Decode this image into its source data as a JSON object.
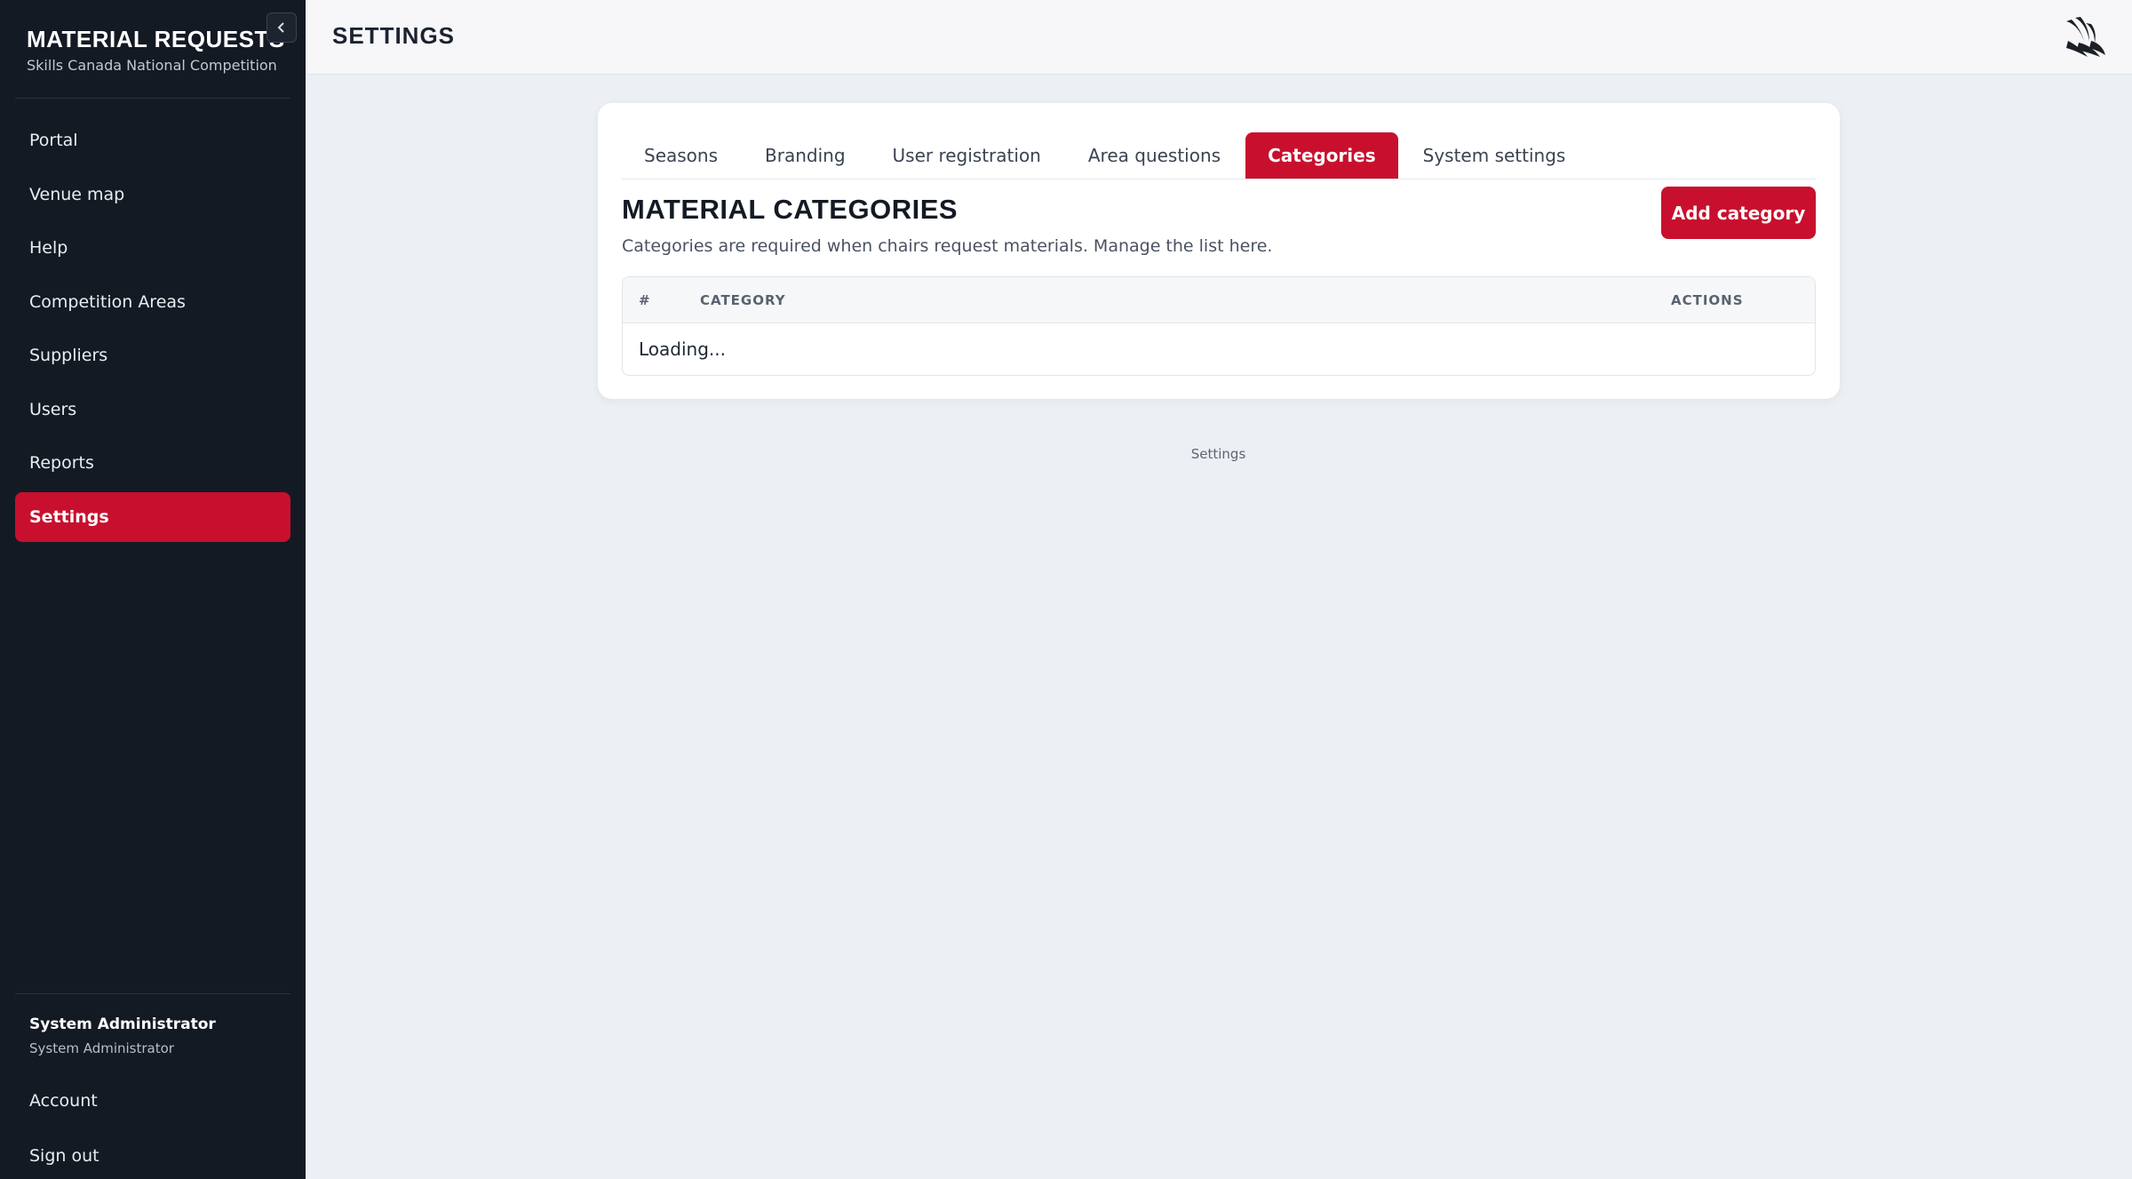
{
  "app": {
    "title": "MATERIAL REQUESTS",
    "subtitle": "Skills Canada National Competition"
  },
  "sidebar": {
    "items": [
      {
        "label": "Portal"
      },
      {
        "label": "Venue map"
      },
      {
        "label": "Help"
      },
      {
        "label": "Competition Areas"
      },
      {
        "label": "Suppliers"
      },
      {
        "label": "Users"
      },
      {
        "label": "Reports"
      },
      {
        "label": "Settings",
        "active": true
      }
    ],
    "user": {
      "name": "System Administrator",
      "role": "System Administrator"
    },
    "account_label": "Account",
    "signout_label": "Sign out"
  },
  "header": {
    "title": "SETTINGS"
  },
  "tabs": [
    {
      "label": "Seasons"
    },
    {
      "label": "Branding"
    },
    {
      "label": "User registration"
    },
    {
      "label": "Area questions"
    },
    {
      "label": "Categories",
      "active": true
    },
    {
      "label": "System settings"
    }
  ],
  "section": {
    "title": "MATERIAL CATEGORIES",
    "description": "Categories are required when chairs request materials. Manage the list here.",
    "add_label": "Add category"
  },
  "table": {
    "columns": [
      "#",
      "CATEGORY",
      "ACTIONS"
    ],
    "status": "Loading..."
  },
  "footer": {
    "label": "Settings"
  },
  "colors": {
    "accent": "#c8102e",
    "sidebar_bg": "#141a24"
  }
}
